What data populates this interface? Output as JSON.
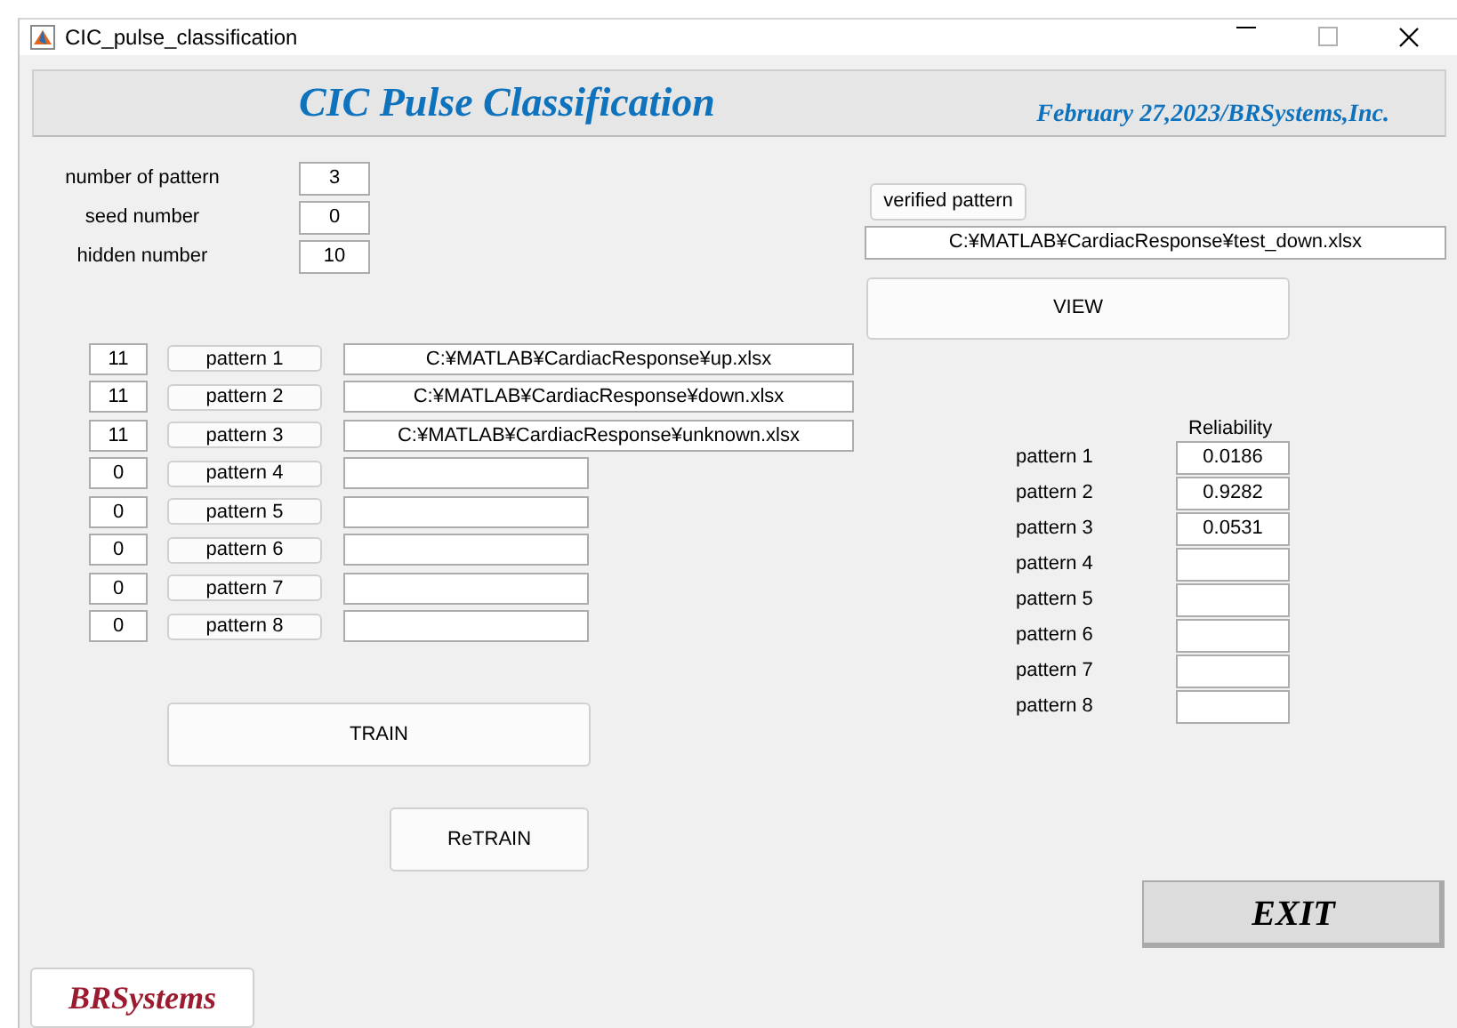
{
  "window": {
    "title": "CIC_pulse_classification"
  },
  "header": {
    "title": "CIC Pulse Classification",
    "subtitle": "February 27,2023/BRSystems,Inc."
  },
  "settings": [
    {
      "label": "number of pattern",
      "value": "3"
    },
    {
      "label": "seed number",
      "value": "0"
    },
    {
      "label": "hidden number",
      "value": "10"
    }
  ],
  "patterns": [
    {
      "count": "11",
      "button": "pattern 1",
      "path": "C:¥MATLAB¥CardiacResponse¥up.xlsx"
    },
    {
      "count": "11",
      "button": "pattern 2",
      "path": "C:¥MATLAB¥CardiacResponse¥down.xlsx"
    },
    {
      "count": "11",
      "button": "pattern 3",
      "path": "C:¥MATLAB¥CardiacResponse¥unknown.xlsx"
    },
    {
      "count": "0",
      "button": "pattern 4"
    },
    {
      "count": "0",
      "button": "pattern 5"
    },
    {
      "count": "0",
      "button": "pattern 6"
    },
    {
      "count": "0",
      "button": "pattern 7"
    },
    {
      "count": "0",
      "button": "pattern 8"
    }
  ],
  "train_button": "TRAIN",
  "retrain_button": "ReTRAIN",
  "verified": {
    "button": "verified pattern",
    "path": "C:¥MATLAB¥CardiacResponse¥test_down.xlsx"
  },
  "view_button": "VIEW",
  "reliability": {
    "heading": "Reliability",
    "rows": [
      {
        "label": "pattern 1",
        "value": "0.0186"
      },
      {
        "label": "pattern 2",
        "value": "0.9282"
      },
      {
        "label": "pattern 3",
        "value": "0.0531"
      },
      {
        "label": "pattern 4"
      },
      {
        "label": "pattern 5"
      },
      {
        "label": "pattern 6"
      },
      {
        "label": "pattern 7"
      },
      {
        "label": "pattern 8"
      }
    ]
  },
  "exit_button": "EXIT",
  "logo": "BRSystems"
}
